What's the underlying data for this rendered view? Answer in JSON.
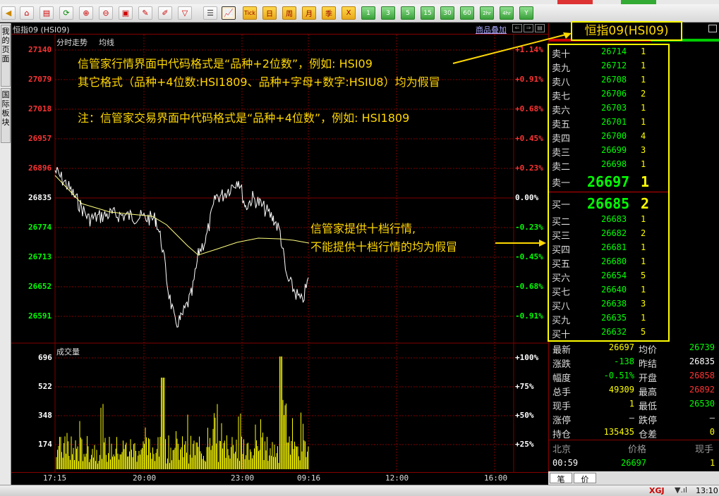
{
  "window": {
    "title_name": "恒指09 (HSI09)",
    "overlay_link": "商品叠加",
    "panel_title": "恒指09(HSI09)"
  },
  "sidebar_tabs": [
    "我的页面",
    "国际板块"
  ],
  "toolbar": {
    "period_buttons": [
      "日",
      "周",
      "月",
      "季",
      "X"
    ],
    "minute_buttons": [
      "1",
      "3",
      "5",
      "15",
      "30",
      "60",
      "2hr",
      "4hr",
      "Y"
    ],
    "tick_button": "Tick"
  },
  "chart_tabs": {
    "tab1": "分时走势",
    "tab2": "均线"
  },
  "volume_title": "成交量",
  "price_axis": {
    "labels": [
      "27140",
      "27079",
      "27018",
      "26957",
      "26896",
      "26835",
      "26774",
      "26713",
      "26652",
      "26591"
    ],
    "pct_labels": [
      "+1.14%",
      "+0.91%",
      "+0.68%",
      "+0.45%",
      "+0.23%",
      "0.00%",
      "-0.23%",
      "-0.45%",
      "-0.68%",
      "-0.91%"
    ]
  },
  "volume_axis": {
    "labels": [
      "696",
      "522",
      "348",
      "174"
    ],
    "pct_labels": [
      "+100%",
      "+75%",
      "+50%",
      "+25%"
    ]
  },
  "time_axis": [
    "17:15",
    "20:00",
    "23:00",
    "09:16",
    "12:00",
    "16:00"
  ],
  "annotations": {
    "line1": "信管家行情界面中代码格式是“品种+2位数”，例如: HSI09",
    "line2": "其它格式（品种+4位数:HSI1809、品种+字母+数字:HSIU8）均为假冒",
    "line3": "注：信管家交易界面中代码格式是“品种+4位数”，例如: HSI1809",
    "line4": "信管家提供十档行情,",
    "line5": "不能提供十档行情的均为假冒"
  },
  "order_book": {
    "asks": [
      {
        "label": "卖十",
        "price": "26714",
        "vol": "1"
      },
      {
        "label": "卖九",
        "price": "26712",
        "vol": "1"
      },
      {
        "label": "卖八",
        "price": "26708",
        "vol": "1"
      },
      {
        "label": "卖七",
        "price": "26706",
        "vol": "2"
      },
      {
        "label": "卖六",
        "price": "26703",
        "vol": "1"
      },
      {
        "label": "卖五",
        "price": "26701",
        "vol": "1"
      },
      {
        "label": "卖四",
        "price": "26700",
        "vol": "4"
      },
      {
        "label": "卖三",
        "price": "26699",
        "vol": "3"
      },
      {
        "label": "卖二",
        "price": "26698",
        "vol": "1"
      },
      {
        "label": "卖一",
        "price": "26697",
        "vol": "1"
      }
    ],
    "bids": [
      {
        "label": "买一",
        "price": "26685",
        "vol": "2"
      },
      {
        "label": "买二",
        "price": "26683",
        "vol": "1"
      },
      {
        "label": "买三",
        "price": "26682",
        "vol": "2"
      },
      {
        "label": "买四",
        "price": "26681",
        "vol": "1"
      },
      {
        "label": "买五",
        "price": "26680",
        "vol": "1"
      },
      {
        "label": "买六",
        "price": "26654",
        "vol": "5"
      },
      {
        "label": "买七",
        "price": "26640",
        "vol": "1"
      },
      {
        "label": "买八",
        "price": "26638",
        "vol": "3"
      },
      {
        "label": "买九",
        "price": "26635",
        "vol": "1"
      },
      {
        "label": "买十",
        "price": "26632",
        "vol": "5"
      }
    ]
  },
  "stats": [
    {
      "l": "最新",
      "v": "26697",
      "vc": "#ff0",
      "l2": "均价",
      "v2": "26739",
      "v2c": "#0f0"
    },
    {
      "l": "涨跌",
      "v": "-138",
      "vc": "#0f0",
      "l2": "昨结",
      "v2": "26835",
      "v2c": "#fff"
    },
    {
      "l": "幅度",
      "v": "-0.51%",
      "vc": "#0f0",
      "l2": "开盘",
      "v2": "26858",
      "v2c": "#f33"
    },
    {
      "l": "总手",
      "v": "49309",
      "vc": "#ff0",
      "l2": "最高",
      "v2": "26892",
      "v2c": "#f33"
    },
    {
      "l": "现手",
      "v": "1",
      "vc": "#ff0",
      "l2": "最低",
      "v2": "26530",
      "v2c": "#0f0"
    },
    {
      "l": "涨停",
      "v": "—",
      "vc": "#ddd",
      "l2": "跌停",
      "v2": "—",
      "v2c": "#ddd"
    },
    {
      "l": "持仓",
      "v": "135435",
      "vc": "#ff0",
      "l2": "仓差",
      "v2": "0",
      "v2c": "#ff0"
    }
  ],
  "ticks_header": {
    "c1": "北京",
    "c2": "价格",
    "c3": "现手"
  },
  "tick_row": {
    "time": "00:59",
    "price": "26697",
    "vol": "1"
  },
  "bottom_tabs": [
    "笔",
    "价"
  ],
  "status": {
    "brand": "XGJ",
    "time": "13:10"
  },
  "colors": {
    "up": "#ff3333",
    "down": "#00ff00",
    "price_line": "#ffffff",
    "avg_line": "#ffff80",
    "volume": "#ffff00",
    "grid": "#800000",
    "accent": "#ffd800"
  }
}
